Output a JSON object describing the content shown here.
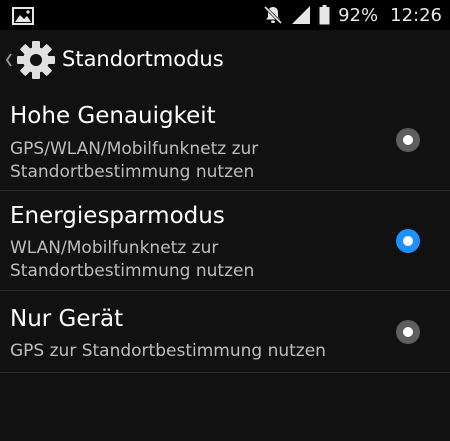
{
  "status_bar": {
    "battery_percent": "92%",
    "time": "12:26",
    "icons": [
      "image-icon",
      "notifications-off-icon",
      "signal-icon",
      "battery-icon"
    ]
  },
  "app_bar": {
    "title": "Standortmodus",
    "icons": [
      "back-chevron-icon",
      "settings-gear-icon"
    ]
  },
  "options": [
    {
      "title": "Hohe Genauigkeit",
      "subtitle": "GPS/WLAN/Mobilfunknetz zur Standortbestimmung nutzen",
      "selected": false
    },
    {
      "title": "Energiesparmodus",
      "subtitle": "WLAN/Mobilfunknetz zur Standortbestimmung nutzen",
      "selected": true
    },
    {
      "title": "Nur Gerät",
      "subtitle": "GPS zur Standortbestimmung nutzen",
      "selected": false
    }
  ],
  "colors": {
    "accent": "#1e90ff",
    "background": "#111111",
    "status_bar": "#000000",
    "radio_off": "#5f5f5f"
  }
}
